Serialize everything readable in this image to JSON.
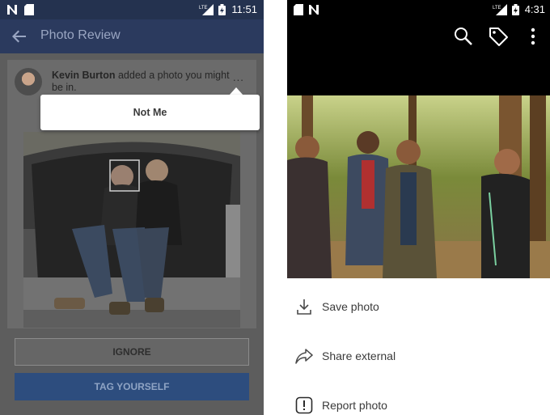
{
  "left_screen": {
    "status_bar": {
      "time": "11:51",
      "network_label": "LTE"
    },
    "app_bar": {
      "title": "Photo Review"
    },
    "notification": {
      "user_name": "Kevin Burton",
      "message": " added a photo you might be in.",
      "more_label": "..."
    },
    "popup_menu": {
      "item": "Not Me"
    },
    "buttons": {
      "ignore": "IGNORE",
      "tag_yourself": "TAG YOURSELF"
    }
  },
  "right_screen": {
    "status_bar": {
      "time": "4:31",
      "network_label": "LTE"
    },
    "menu": [
      {
        "label": "Save photo",
        "icon": "download-icon"
      },
      {
        "label": "Share external",
        "icon": "share-icon"
      },
      {
        "label": "Report photo",
        "icon": "report-icon"
      }
    ]
  },
  "colors": {
    "status_bar_left": "#24324f",
    "app_bar": "#2b3a5e",
    "tag_button": "#2d4d7e",
    "popup_bg": "#ffffff"
  }
}
